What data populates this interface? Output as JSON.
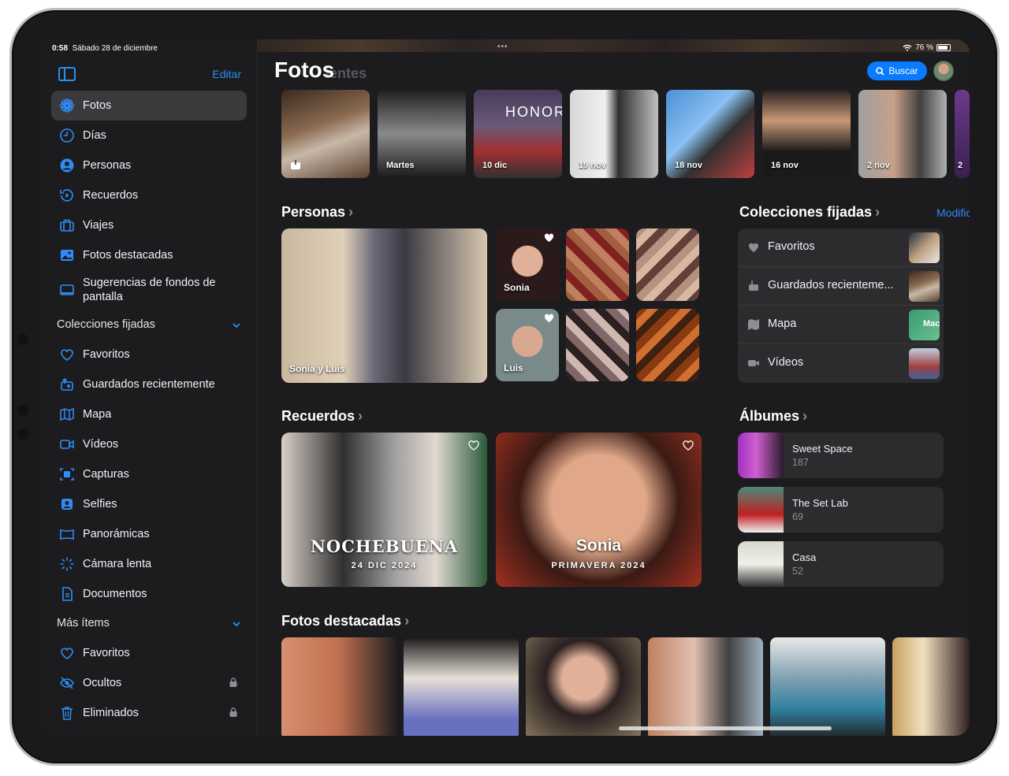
{
  "status": {
    "time": "0:58",
    "date": "Sábado 28 de diciembre",
    "battery": "76 %"
  },
  "sidebar": {
    "edit_label": "Editar",
    "items": [
      {
        "label": "Fotos",
        "icon": "photos-flower-icon"
      },
      {
        "label": "Días",
        "icon": "clock-icon"
      },
      {
        "label": "Personas",
        "icon": "person-circle-icon"
      },
      {
        "label": "Recuerdos",
        "icon": "memories-icon"
      },
      {
        "label": "Viajes",
        "icon": "suitcase-icon"
      },
      {
        "label": "Fotos destacadas",
        "icon": "photo-icon"
      },
      {
        "label": "Sugerencias de fondos de pantalla",
        "icon": "wallpaper-icon"
      }
    ],
    "pinned_header": "Colecciones fijadas",
    "pinned_items": [
      {
        "label": "Favoritos",
        "icon": "heart-icon"
      },
      {
        "label": "Guardados recientemente",
        "icon": "saved-icon"
      },
      {
        "label": "Mapa",
        "icon": "map-icon"
      },
      {
        "label": "Vídeos",
        "icon": "video-icon"
      },
      {
        "label": "Capturas",
        "icon": "screenshot-icon"
      },
      {
        "label": "Selfies",
        "icon": "selfie-icon"
      },
      {
        "label": "Panorámicas",
        "icon": "panorama-icon"
      },
      {
        "label": "Cámara lenta",
        "icon": "slow-motion-icon"
      },
      {
        "label": "Documentos",
        "icon": "document-icon"
      }
    ],
    "more_header": "Más ítems",
    "more_items": [
      {
        "label": "Favoritos",
        "icon": "heart-icon"
      },
      {
        "label": "Ocultos",
        "icon": "eye-slash-icon"
      },
      {
        "label": "Eliminados",
        "icon": "trash-icon"
      }
    ]
  },
  "main": {
    "title": "Fotos",
    "ghost_title": "ientes",
    "search_label": "Buscar",
    "recent_thumbs": [
      {
        "caption": ""
      },
      {
        "caption": "Martes"
      },
      {
        "caption": "10 dic"
      },
      {
        "caption": "19 nov"
      },
      {
        "caption": "18 nov"
      },
      {
        "caption": "16 nov"
      },
      {
        "caption": "2 nov"
      },
      {
        "caption": "2"
      }
    ],
    "honor_text": "HONOR",
    "people_title": "Personas",
    "people_main_caption": "Sonia y Luis",
    "people_small": [
      {
        "name": "Sonia"
      },
      {
        "name": "Luis"
      }
    ],
    "pinned_title": "Colecciones fijadas",
    "modify_label": "Modificar",
    "pinned_rows": [
      {
        "label": "Favoritos"
      },
      {
        "label": "Guardados recienteme..."
      },
      {
        "label": "Mapa",
        "thumb_text": "Mac"
      },
      {
        "label": "Vídeos"
      }
    ],
    "memories_title": "Recuerdos",
    "memories": [
      {
        "title": "NOCHEBUENA",
        "subtitle": "24 DIC 2024"
      },
      {
        "title": "Sonia",
        "subtitle": "PRIMAVERA 2024"
      }
    ],
    "albums_title": "Álbumes",
    "albums": [
      {
        "name": "Sweet Space",
        "count": "187"
      },
      {
        "name": "The Set Lab",
        "count": "69"
      },
      {
        "name": "Casa",
        "count": "52"
      }
    ],
    "featured_title": "Fotos destacadas",
    "colors": {
      "accent": "#0a7aff",
      "background": "#1c1c1e",
      "card": "#2c2c2e"
    }
  }
}
